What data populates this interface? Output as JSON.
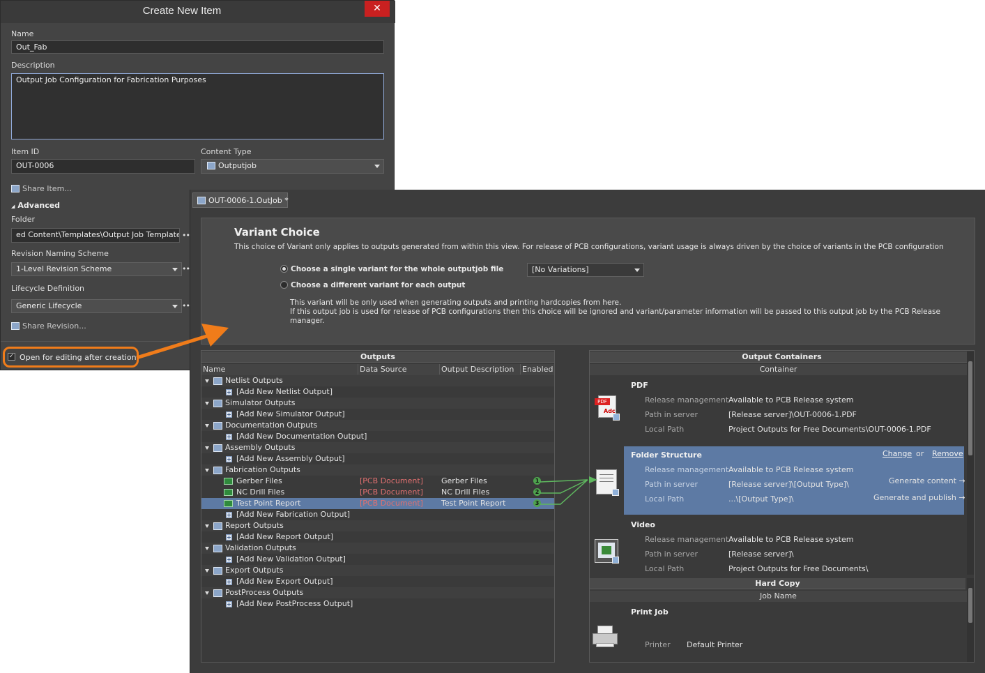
{
  "dialog": {
    "title": "Create New Item",
    "close_label": "✕",
    "name_label": "Name",
    "name_value": "Out_Fab",
    "description_label": "Description",
    "description_value": "Output Job Configuration for Fabrication Purposes",
    "item_id_label": "Item ID",
    "item_id_value": "OUT-0006",
    "content_type_label": "Content Type",
    "content_type_value": "Outputjob",
    "share_item": "Share Item...",
    "advanced": "Advanced",
    "folder_label": "Folder",
    "folder_value": "ed Content\\Templates\\Output Job Templates",
    "revision_label": "Revision Naming Scheme",
    "revision_value": "1-Level Revision Scheme",
    "lifecycle_label": "Lifecycle Definition",
    "lifecycle_value": "Generic Lifecycle",
    "share_revision": "Share Revision...",
    "open_editing": "Open for editing after creation",
    "ellipsis": "•••"
  },
  "editor": {
    "tab_label": "OUT-0006-1.OutJob *",
    "variant": {
      "title": "Variant Choice",
      "intro": "This choice of Variant only applies to outputs generated from within this view. For release of PCB configurations, variant usage is always driven by the choice of variants in the PCB configuration",
      "option_single": "Choose a single variant for the whole outputjob file",
      "option_each": "Choose a different variant for each output",
      "variant_select": "[No Variations]",
      "note_1": "This variant will be only used when generating outputs and printing hardcopies from here.",
      "note_2": "If this output job is used for release of PCB configurations then this choice will be ignored and variant/parameter information will be passed to this output job by the PCB Release",
      "note_3": "manager."
    },
    "outputs": {
      "title": "Outputs",
      "columns": [
        "Name",
        "Data Source",
        "Output Description",
        "Enabled"
      ],
      "groups": [
        {
          "name": "Netlist Outputs",
          "items": [],
          "add": "[Add New Netlist Output]"
        },
        {
          "name": "Simulator Outputs",
          "items": [],
          "add": "[Add New Simulator Output]"
        },
        {
          "name": "Documentation Outputs",
          "items": [],
          "add": "[Add New Documentation Output]"
        },
        {
          "name": "Assembly Outputs",
          "items": [],
          "add": "[Add New Assembly Output]"
        },
        {
          "name": "Fabrication Outputs",
          "items": [
            {
              "name": "Gerber Files",
              "source": "[PCB Document]",
              "desc": "Gerber Files",
              "badge": "1"
            },
            {
              "name": "NC Drill Files",
              "source": "[PCB Document]",
              "desc": "NC Drill Files",
              "badge": "2"
            },
            {
              "name": "Test Point Report",
              "source": "[PCB Document]",
              "desc": "Test Point Report",
              "badge": "3"
            }
          ],
          "add": "[Add New Fabrication Output]"
        },
        {
          "name": "Report Outputs",
          "items": [],
          "add": "[Add New Report Output]"
        },
        {
          "name": "Validation Outputs",
          "items": [],
          "add": "[Add New Validation Output]"
        },
        {
          "name": "Export Outputs",
          "items": [],
          "add": "[Add New Export Output]"
        },
        {
          "name": "PostProcess Outputs",
          "items": [],
          "add": "[Add New PostProcess Output]"
        }
      ]
    },
    "containers": {
      "title": "Output Containers",
      "column": "Container",
      "labels": {
        "release": "Release management",
        "server": "Path in server",
        "local": "Local Path",
        "printer": "Printer"
      },
      "pdf": {
        "name": "PDF",
        "release": "Available to PCB Release system",
        "server": "[Release server]\\OUT-0006-1.PDF",
        "local": "Project Outputs for Free Documents\\OUT-0006-1.PDF",
        "icon_text": "PDF",
        "icon_sub": "Adc"
      },
      "folder": {
        "name": "Folder Structure",
        "release": "Available to PCB Release system",
        "server": "[Release server]\\[Output Type]\\",
        "local": "...\\[Output Type]\\",
        "change": "Change",
        "or": "or",
        "remove": "Remove",
        "generate": "Generate content",
        "generate_publish": "Generate and publish",
        "arrow": "→"
      },
      "video": {
        "name": "Video",
        "release": "Available to PCB Release system",
        "server": "[Release server]\\",
        "local": "Project Outputs for Free Documents\\"
      },
      "hardcopy_title": "Hard Copy",
      "hardcopy_column": "Job Name",
      "print_job": {
        "name": "Print Job",
        "printer": "Default Printer"
      }
    }
  },
  "colors": {
    "accent_orange": "#f07c1a",
    "selection_blue": "#5d7aa4",
    "badge_green": "#4ea34e",
    "source_red": "#e07070"
  }
}
